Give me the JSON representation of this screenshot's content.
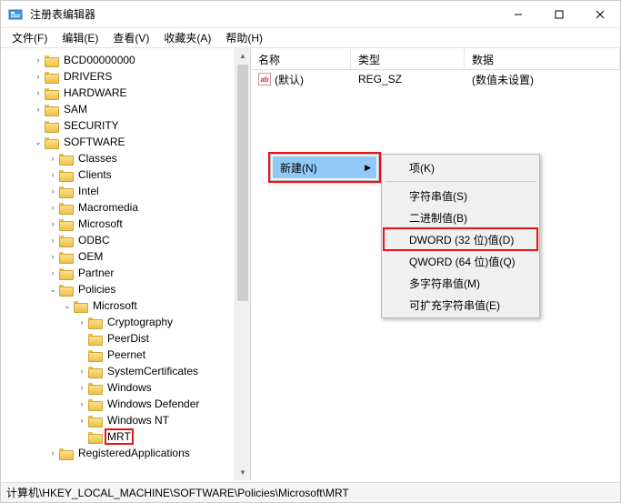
{
  "title": "注册表编辑器",
  "menubar": [
    "文件(F)",
    "编辑(E)",
    "查看(V)",
    "收藏夹(A)",
    "帮助(H)"
  ],
  "list": {
    "headers": [
      "名称",
      "类型",
      "数据"
    ],
    "rows": [
      {
        "name": "(默认)",
        "type": "REG_SZ",
        "data": "(数值未设置)"
      }
    ]
  },
  "tree": [
    {
      "depth": 2,
      "exp": ">",
      "label": "BCD00000000"
    },
    {
      "depth": 2,
      "exp": ">",
      "label": "DRIVERS"
    },
    {
      "depth": 2,
      "exp": ">",
      "label": "HARDWARE"
    },
    {
      "depth": 2,
      "exp": ">",
      "label": "SAM"
    },
    {
      "depth": 2,
      "exp": "",
      "label": "SECURITY"
    },
    {
      "depth": 2,
      "exp": "v",
      "label": "SOFTWARE"
    },
    {
      "depth": 3,
      "exp": ">",
      "label": "Classes"
    },
    {
      "depth": 3,
      "exp": ">",
      "label": "Clients"
    },
    {
      "depth": 3,
      "exp": ">",
      "label": "Intel"
    },
    {
      "depth": 3,
      "exp": ">",
      "label": "Macromedia"
    },
    {
      "depth": 3,
      "exp": ">",
      "label": "Microsoft"
    },
    {
      "depth": 3,
      "exp": ">",
      "label": "ODBC"
    },
    {
      "depth": 3,
      "exp": ">",
      "label": "OEM"
    },
    {
      "depth": 3,
      "exp": ">",
      "label": "Partner"
    },
    {
      "depth": 3,
      "exp": "v",
      "label": "Policies"
    },
    {
      "depth": 4,
      "exp": "v",
      "label": "Microsoft"
    },
    {
      "depth": 5,
      "exp": ">",
      "label": "Cryptography"
    },
    {
      "depth": 5,
      "exp": "",
      "label": "PeerDist"
    },
    {
      "depth": 5,
      "exp": "",
      "label": "Peernet"
    },
    {
      "depth": 5,
      "exp": ">",
      "label": "SystemCertificates"
    },
    {
      "depth": 5,
      "exp": ">",
      "label": "Windows"
    },
    {
      "depth": 5,
      "exp": ">",
      "label": "Windows Defender"
    },
    {
      "depth": 5,
      "exp": ">",
      "label": "Windows NT"
    },
    {
      "depth": 5,
      "exp": "",
      "label": "MRT",
      "hl": true
    },
    {
      "depth": 3,
      "exp": ">",
      "label": "RegisteredApplications"
    }
  ],
  "ctx": {
    "primary": {
      "label": "新建(N)"
    },
    "sub": [
      {
        "label": "项(K)",
        "sep_after": true
      },
      {
        "label": "字符串值(S)"
      },
      {
        "label": "二进制值(B)"
      },
      {
        "label": "DWORD (32 位)值(D)",
        "hl": true
      },
      {
        "label": "QWORD (64 位)值(Q)"
      },
      {
        "label": "多字符串值(M)"
      },
      {
        "label": "可扩充字符串值(E)"
      }
    ]
  },
  "statusbar": "计算机\\HKEY_LOCAL_MACHINE\\SOFTWARE\\Policies\\Microsoft\\MRT"
}
